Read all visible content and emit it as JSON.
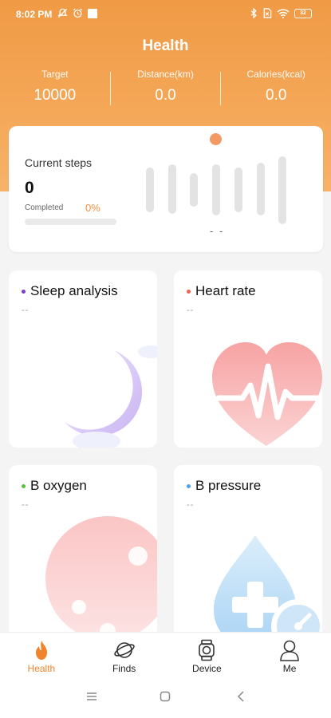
{
  "status": {
    "time": "8:02 PM",
    "battery": "32"
  },
  "header": {
    "title": "Health",
    "stats": [
      {
        "label": "Target",
        "value": "10000"
      },
      {
        "label": "Distance(km)",
        "value": "0.0"
      },
      {
        "label": "Calories(kcal)",
        "value": "0.0"
      }
    ]
  },
  "steps": {
    "label": "Current steps",
    "value": "0",
    "completed_label": "Completed",
    "completed_pct": "0%",
    "progress": 0,
    "dashes": "- -"
  },
  "cards": {
    "sleep": {
      "title": "Sleep analysis",
      "value": "--",
      "dot_color": "#7a3cc9"
    },
    "heart": {
      "title": "Heart rate",
      "value": "--",
      "dot_color": "#f0624a"
    },
    "oxygen": {
      "title": "B oxygen",
      "value": "--",
      "dot_color": "#53c43b"
    },
    "pressure": {
      "title": "B pressure",
      "value": "--",
      "dot_color": "#4aa3e8"
    }
  },
  "nav": [
    {
      "label": "Health",
      "icon": "flame-icon",
      "active": true
    },
    {
      "label": "Finds",
      "icon": "planet-icon",
      "active": false
    },
    {
      "label": "Device",
      "icon": "watch-icon",
      "active": false
    },
    {
      "label": "Me",
      "icon": "person-icon",
      "active": false
    }
  ],
  "colors": {
    "accent": "#f0832b",
    "header": "#f3a152"
  }
}
